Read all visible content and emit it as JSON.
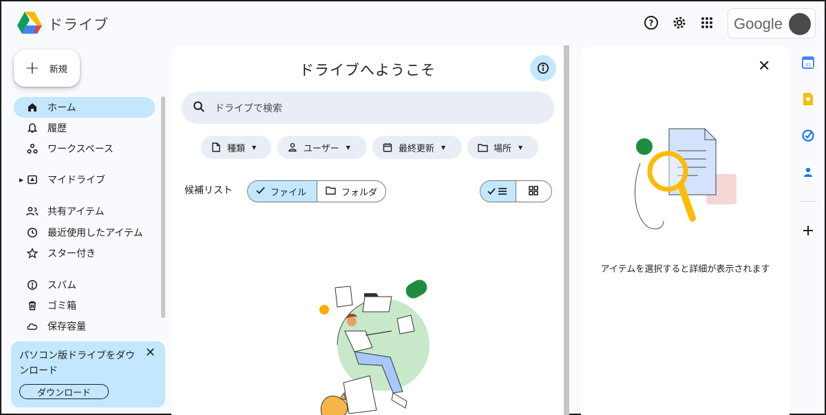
{
  "header": {
    "app_title": "ドライブ",
    "help_icon": "help-icon",
    "settings_icon": "gear-icon",
    "apps_icon": "apps-grid-icon",
    "account_brand": "Google"
  },
  "sidebar": {
    "new_label": "新規",
    "items": [
      {
        "label": "ホーム",
        "icon": "home-icon",
        "active": true
      },
      {
        "label": "履歴",
        "icon": "bell-icon"
      },
      {
        "label": "ワークスペース",
        "icon": "workspaces-icon"
      },
      {
        "label": "マイドライブ",
        "icon": "my-drive-icon"
      },
      {
        "label": "共有アイテム",
        "icon": "shared-people-icon"
      },
      {
        "label": "最近使用したアイテム",
        "icon": "clock-icon"
      },
      {
        "label": "スター付き",
        "icon": "star-icon"
      },
      {
        "label": "スパム",
        "icon": "spam-icon"
      },
      {
        "label": "ゴミ箱",
        "icon": "trash-icon"
      },
      {
        "label": "保存容量",
        "icon": "cloud-icon"
      }
    ],
    "promo": {
      "text": "パソコン版ドライブをダウンロード",
      "button": "ダウンロード"
    }
  },
  "main": {
    "title": "ドライブへようこそ",
    "search_placeholder": "ドライブで検索",
    "filters": [
      {
        "label": "種類",
        "icon": "file-icon"
      },
      {
        "label": "ユーザー",
        "icon": "person-icon"
      },
      {
        "label": "最終更新",
        "icon": "calendar-icon"
      },
      {
        "label": "場所",
        "icon": "folder-icon"
      }
    ],
    "suggested_label": "候補リスト",
    "segment": {
      "files": "ファイル",
      "folders": "フォルダ"
    }
  },
  "details": {
    "message": "アイテムを選択すると詳細が表示されます"
  },
  "side_apps": [
    "calendar-icon",
    "keep-icon",
    "tasks-icon",
    "contacts-icon",
    "add-icon"
  ],
  "colors": {
    "accent": "#c2e7ff",
    "background": "#f8fafd",
    "chip": "#e9eef6"
  }
}
